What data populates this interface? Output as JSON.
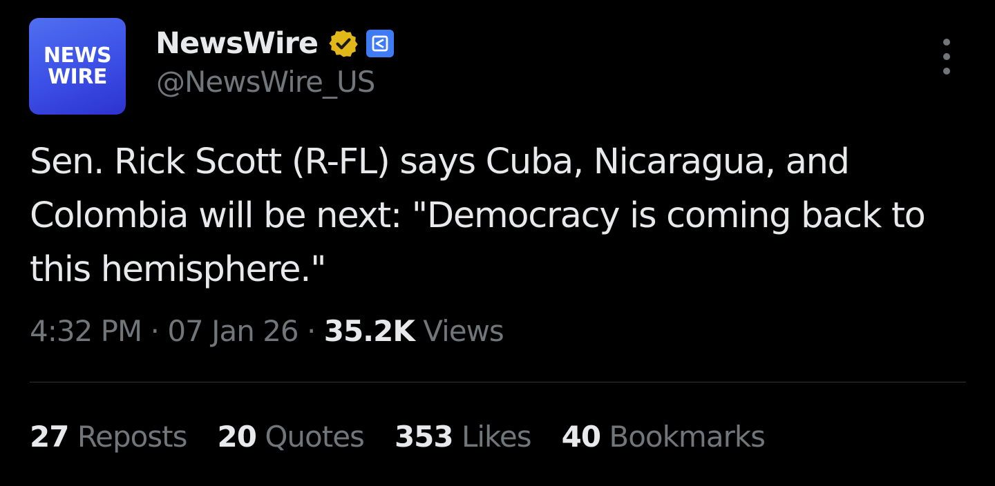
{
  "account": {
    "avatar_line1": "NEWS",
    "avatar_line2": "WIRE",
    "display_name": "NewsWire",
    "handle": "@NewsWire_US",
    "verified_badge_icon": "verified-gold-checkmark-icon",
    "affiliate_badge_icon": "affiliate-badge-icon",
    "accent_color": "#3b4fe6",
    "verified_color": "#e2b719"
  },
  "post": {
    "text": "Sen. Rick Scott (R-FL) says Cuba, Nicaragua, and Colombia will be next: \"Democracy is coming back to this hemisphere.\"",
    "time": "4:32 PM",
    "separator": "·",
    "date": "07 Jan 26",
    "views_count": "35.2K",
    "views_label": "Views"
  },
  "stats": {
    "reposts_count": "27",
    "reposts_label": "Reposts",
    "quotes_count": "20",
    "quotes_label": "Quotes",
    "likes_count": "353",
    "likes_label": "Likes",
    "bookmarks_count": "40",
    "bookmarks_label": "Bookmarks"
  },
  "menu_icon": "more-vertical-icon"
}
